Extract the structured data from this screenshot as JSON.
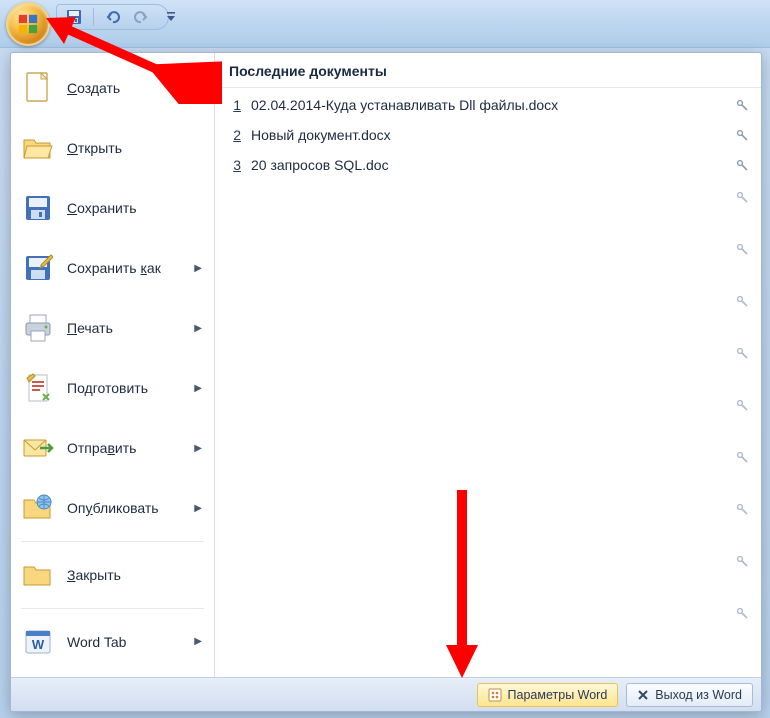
{
  "qat": {
    "save_tip": "Сохранить",
    "undo_tip": "Отменить",
    "redo_tip": "Вернуть",
    "customize_tip": "Настройка панели быстрого доступа"
  },
  "menu": {
    "new_label": "Создать",
    "open_label": "Открыть",
    "save_label": "Сохранить",
    "save_as_label": "Сохранить как",
    "print_label": "Печать",
    "prepare_label": "Подготовить",
    "send_label": "Отправить",
    "publish_label": "Опубликовать",
    "close_label": "Закрыть",
    "wordtab_label": "Word Tab"
  },
  "mnemonics": {
    "new": "С",
    "open": "О",
    "save": "С",
    "save_as": "к",
    "print": "П",
    "prepare": "д",
    "send": "в",
    "publish": "у",
    "close": "З"
  },
  "recent": {
    "header": "Последние документы",
    "items": [
      {
        "num": "1",
        "name": "02.04.2014-Куда устанавливать Dll файлы.docx"
      },
      {
        "num": "2",
        "name": "Новый документ.docx"
      },
      {
        "num": "3",
        "name": "20 запросов SQL.doc"
      }
    ]
  },
  "footer": {
    "options_label": "Параметры Word",
    "exit_label": "Выход из Word"
  },
  "colors": {
    "accent": "#ffe58f",
    "link": "#1d2a40"
  }
}
